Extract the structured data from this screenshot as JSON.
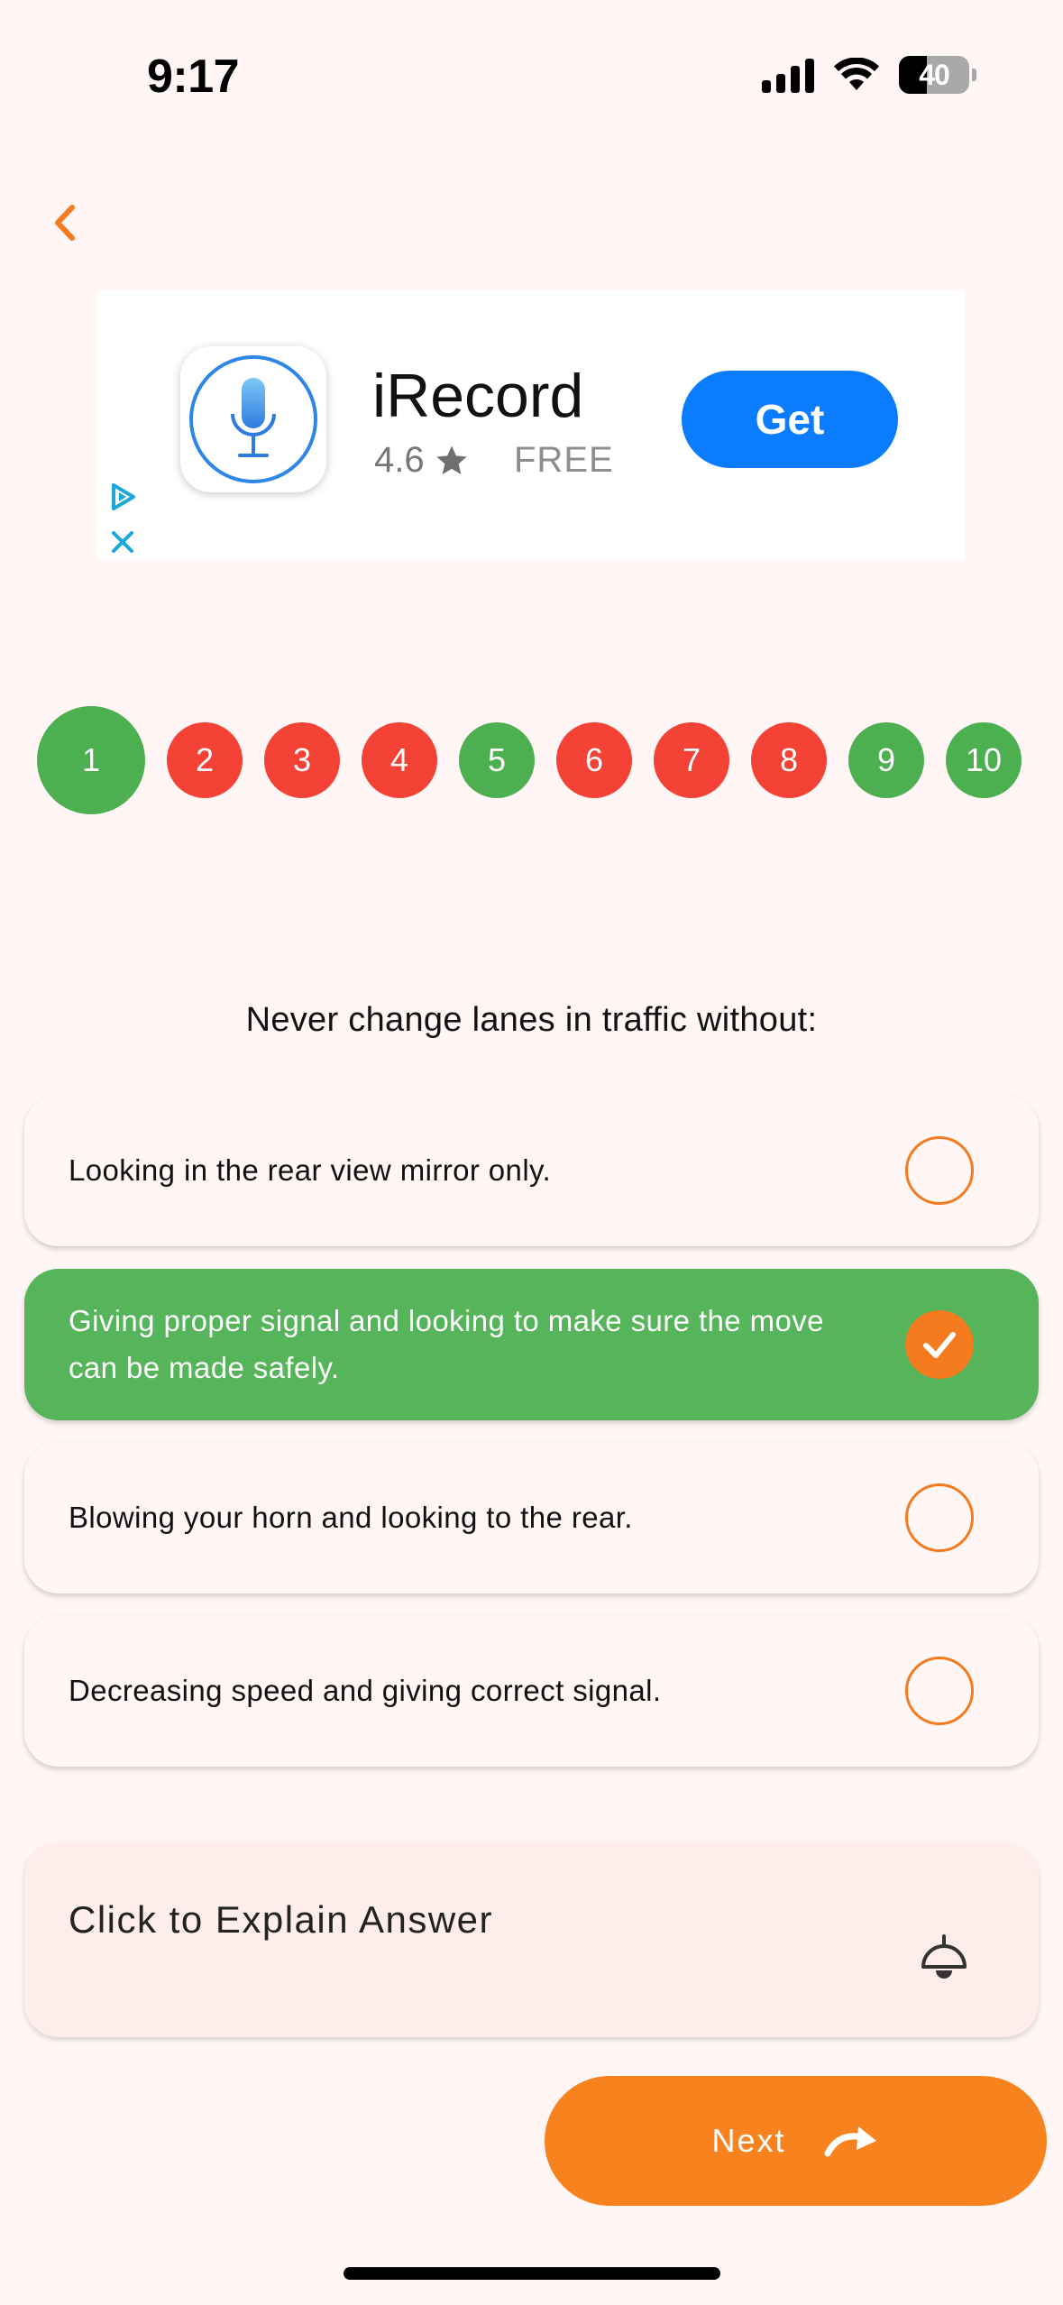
{
  "status_bar": {
    "time": "9:17",
    "battery_level": 40,
    "battery_label": "40"
  },
  "ad": {
    "app_name": "iRecord",
    "rating": "4.6",
    "price": "FREE",
    "cta_label": "Get",
    "icon": "microphone-icon"
  },
  "question_numbers": [
    {
      "label": "1",
      "status": "correct",
      "current": true
    },
    {
      "label": "2",
      "status": "wrong",
      "current": false
    },
    {
      "label": "3",
      "status": "wrong",
      "current": false
    },
    {
      "label": "4",
      "status": "wrong",
      "current": false
    },
    {
      "label": "5",
      "status": "correct",
      "current": false
    },
    {
      "label": "6",
      "status": "wrong",
      "current": false
    },
    {
      "label": "7",
      "status": "wrong",
      "current": false
    },
    {
      "label": "8",
      "status": "wrong",
      "current": false
    },
    {
      "label": "9",
      "status": "correct",
      "current": false
    },
    {
      "label": "10",
      "status": "correct",
      "current": false
    }
  ],
  "colors": {
    "correct": "#4CAF50",
    "wrong": "#F44336",
    "accent": "#F7821E",
    "selected_option": "#56B45A",
    "ad_button": "#0A7CFF"
  },
  "question": {
    "text": "Never change lanes in traffic without:",
    "options": [
      {
        "text": "Looking in the rear view mirror only.",
        "selected": false
      },
      {
        "text": "Giving proper signal and looking to make sure the move can be made safely.",
        "selected": true
      },
      {
        "text": "Blowing your horn and looking to the rear.",
        "selected": false
      },
      {
        "text": "Decreasing speed and giving correct signal.",
        "selected": false
      }
    ]
  },
  "explain": {
    "label": "Click to Explain Answer",
    "icon": "lamp-icon"
  },
  "next": {
    "label": "Next",
    "icon": "redo-arrow-icon"
  }
}
